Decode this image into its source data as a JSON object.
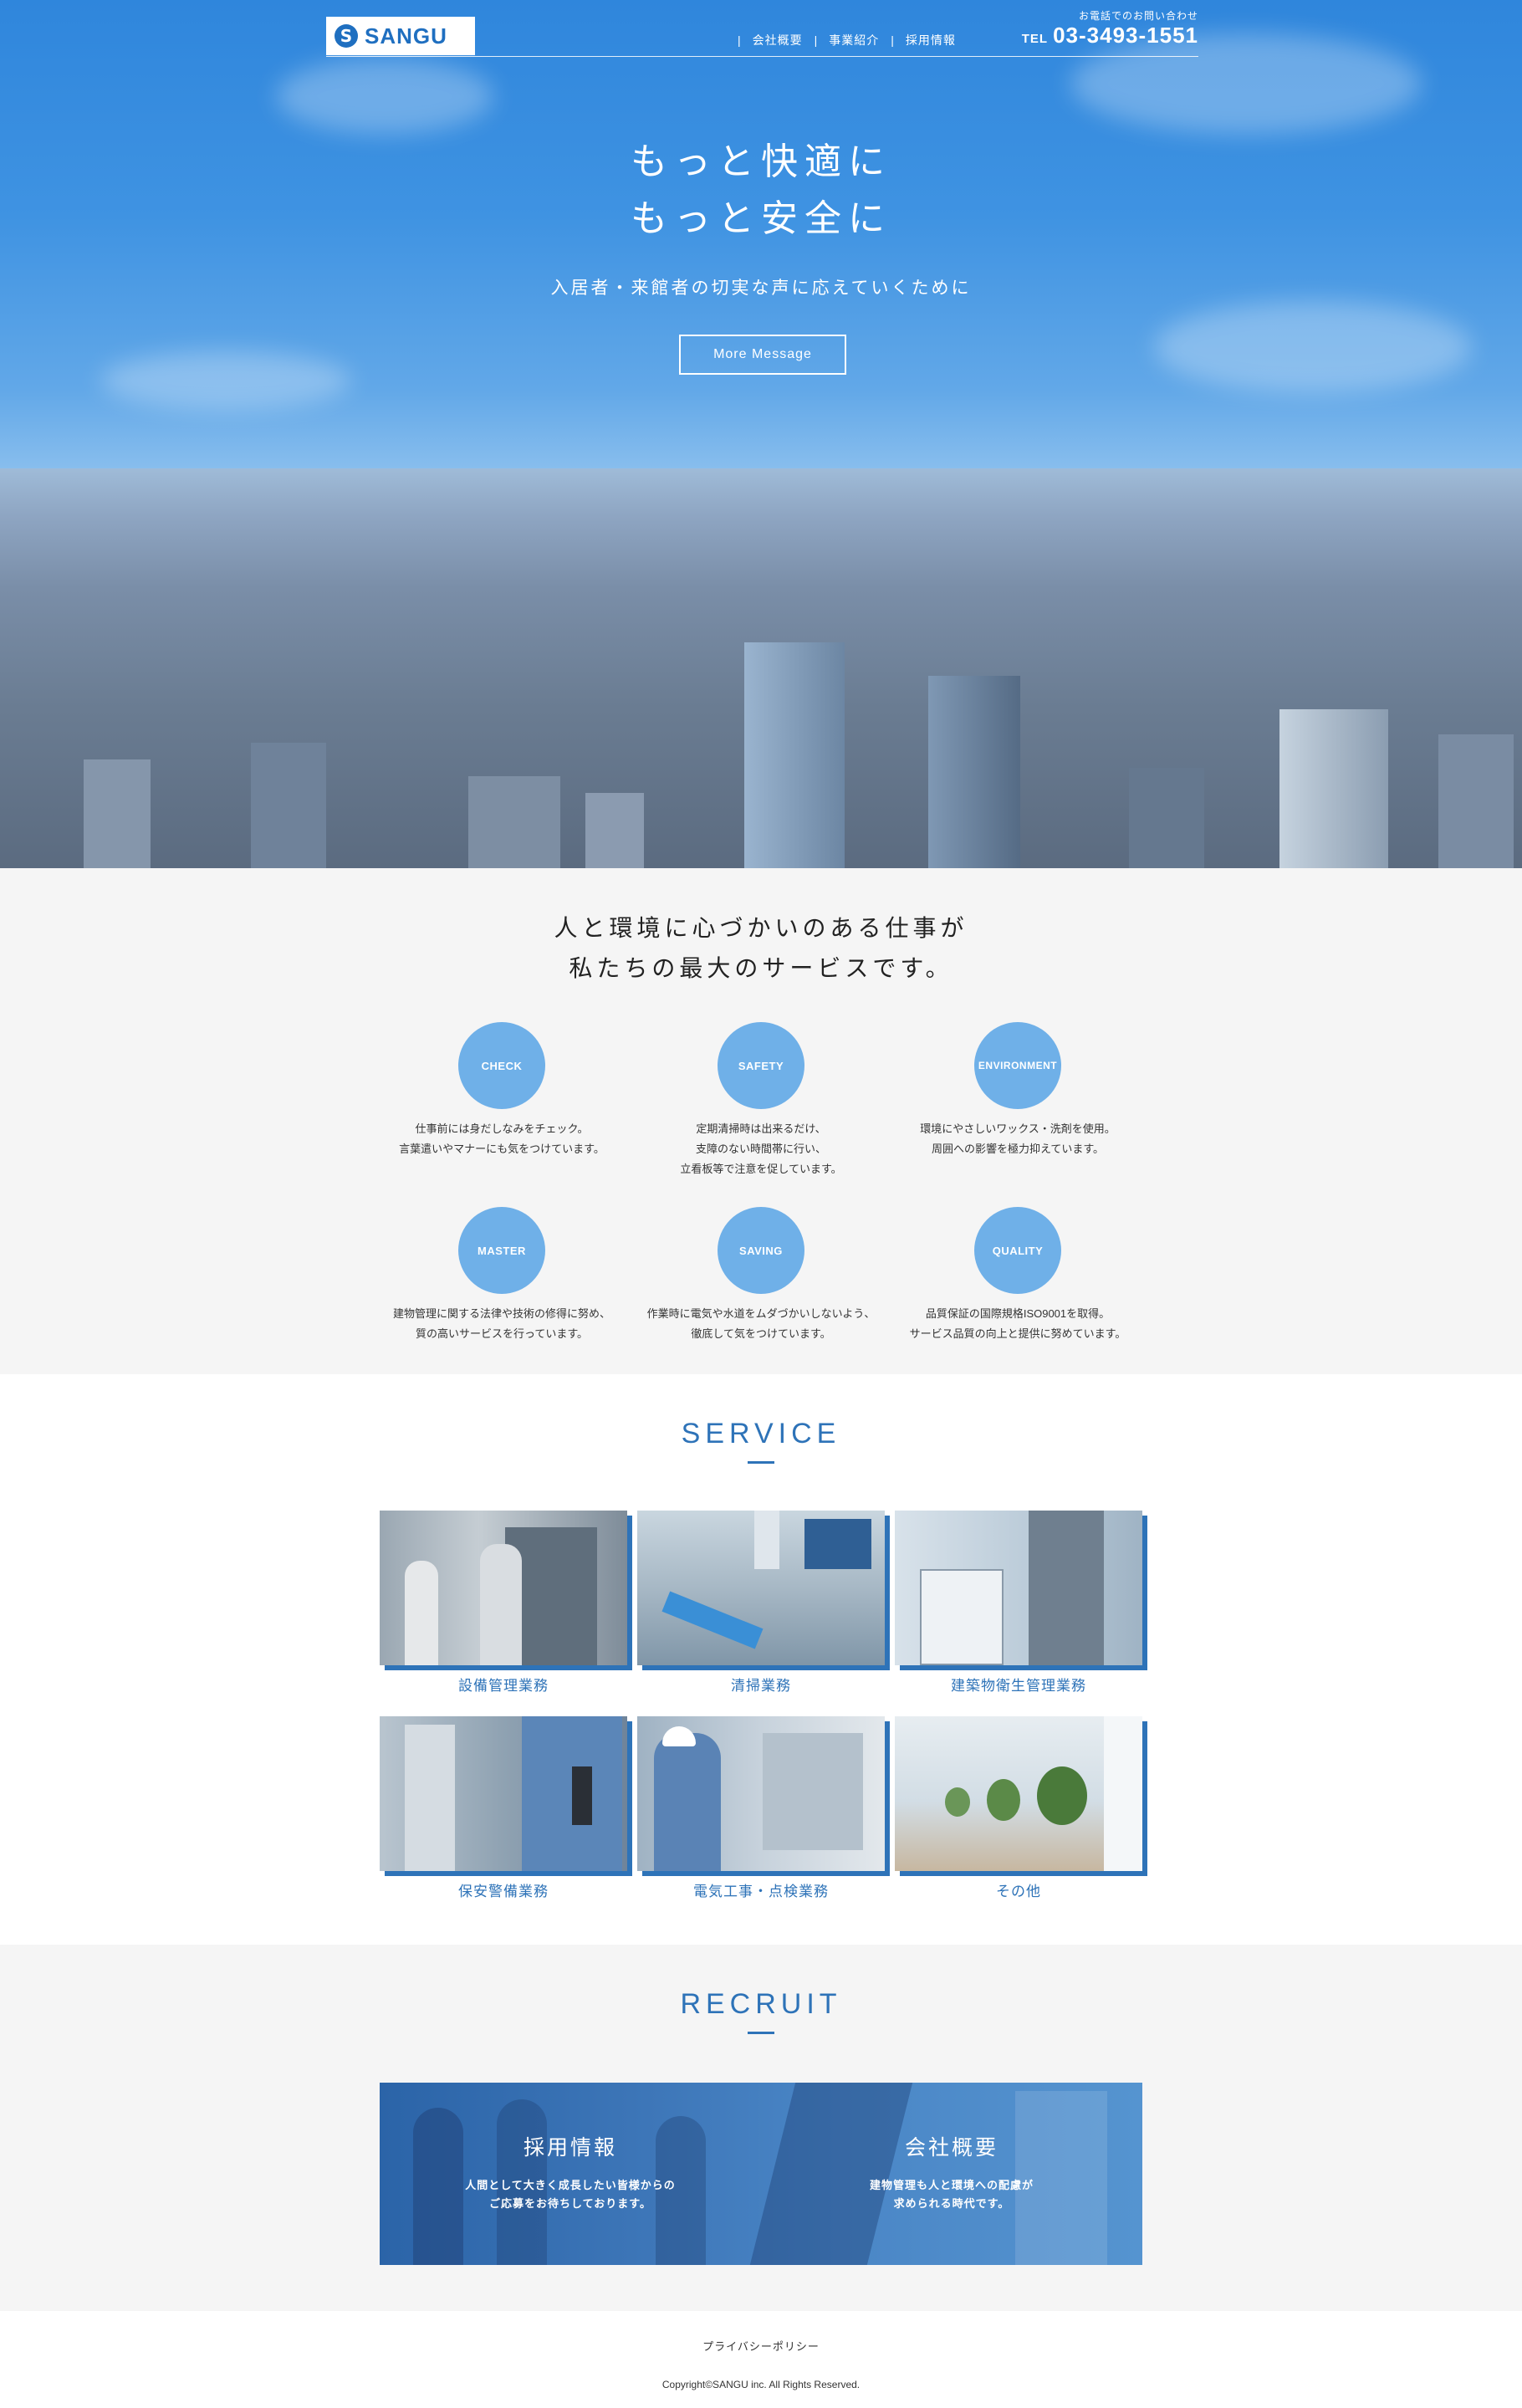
{
  "header": {
    "logo_text": "SANGU",
    "nav": [
      "会社概要",
      "事業紹介",
      "採用情報"
    ],
    "nav_separator": "|",
    "contact_label": "お電話でのお問い合わせ",
    "tel_prefix": "TEL",
    "tel_number": "03-3493-1551"
  },
  "hero": {
    "title_line1": "もっと快適に",
    "title_line2": "もっと安全に",
    "subtitle": "入居者・来館者の切実な声に応えていくために",
    "button_label": "More Message"
  },
  "values": {
    "title_line1": "人と環境に心づかいのある仕事が",
    "title_line2": "私たちの最大のサービスです。",
    "items": [
      {
        "label": "CHECK",
        "lines": [
          "仕事前には身だしなみをチェック。",
          "言葉遣いやマナーにも気をつけています。"
        ]
      },
      {
        "label": "SAFETY",
        "lines": [
          "定期清掃時は出来るだけ、",
          "支障のない時間帯に行い、",
          "立看板等で注意を促しています。"
        ]
      },
      {
        "label": "ENVIRONMENT",
        "lines": [
          "環境にやさしいワックス・洗剤を使用。",
          "周囲への影響を極力抑えています。"
        ]
      },
      {
        "label": "MASTER",
        "lines": [
          "建物管理に関する法律や技術の修得に努め、",
          "質の高いサービスを行っています。"
        ]
      },
      {
        "label": "SAVING",
        "lines": [
          "作業時に電気や水道をムダづかいしないよう、",
          "徹底して気をつけています。"
        ]
      },
      {
        "label": "QUALITY",
        "lines": [
          "品質保証の国際規格ISO9001を取得。",
          "サービス品質の向上と提供に努めています。"
        ]
      }
    ]
  },
  "service": {
    "title": "SERVICE",
    "cards": [
      "設備管理業務",
      "清掃業務",
      "建築物衛生管理業務",
      "保安警備業務",
      "電気工事・点検業務",
      "その他"
    ]
  },
  "recruit": {
    "title": "RECRUIT",
    "left": {
      "heading": "採用情報",
      "line1": "人間として大きく成長したい皆様からの",
      "line2": "ご応募をお待ちしております。"
    },
    "right": {
      "heading": "会社概要",
      "line1": "建物管理も人と環境への配慮が",
      "line2": "求められる時代です。"
    }
  },
  "footer": {
    "privacy": "プライバシーポリシー",
    "copyright": "Copyright©SANGU inc. All Rights Reserved."
  },
  "colors": {
    "accent": "#2e73b8",
    "circle": "#6fb0e8",
    "light_bg": "#f5f5f5"
  }
}
